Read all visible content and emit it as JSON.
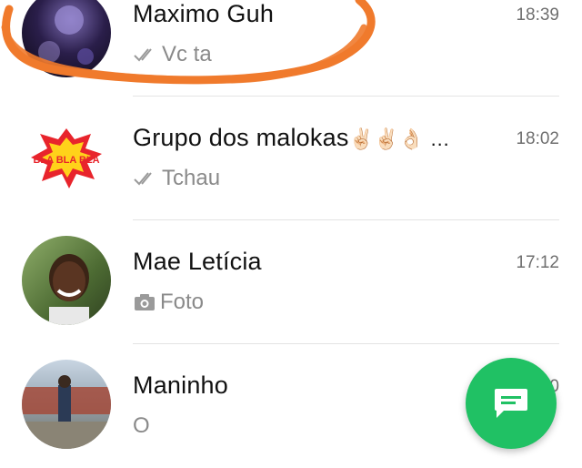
{
  "chats": [
    {
      "name": "Maximo Guh",
      "time": "18:39",
      "preview": "Vc ta",
      "preview_icon": "double-check-icon"
    },
    {
      "name": "Grupo dos malokas",
      "name_emoji": "✌🏻✌🏻👌🏻 …",
      "time": "18:02",
      "preview": "Tchau",
      "preview_icon": "double-check-icon",
      "avatar_text": "BLA BLA BLA"
    },
    {
      "name": "Mae Letícia",
      "time": "17:12",
      "preview": "Foto",
      "preview_icon": "camera-icon"
    },
    {
      "name": "Maninho",
      "time": "0",
      "preview": "O"
    }
  ],
  "fab": {
    "icon": "new-message-icon"
  },
  "colors": {
    "accent": "#20c164",
    "scribble": "#f07a2c"
  }
}
